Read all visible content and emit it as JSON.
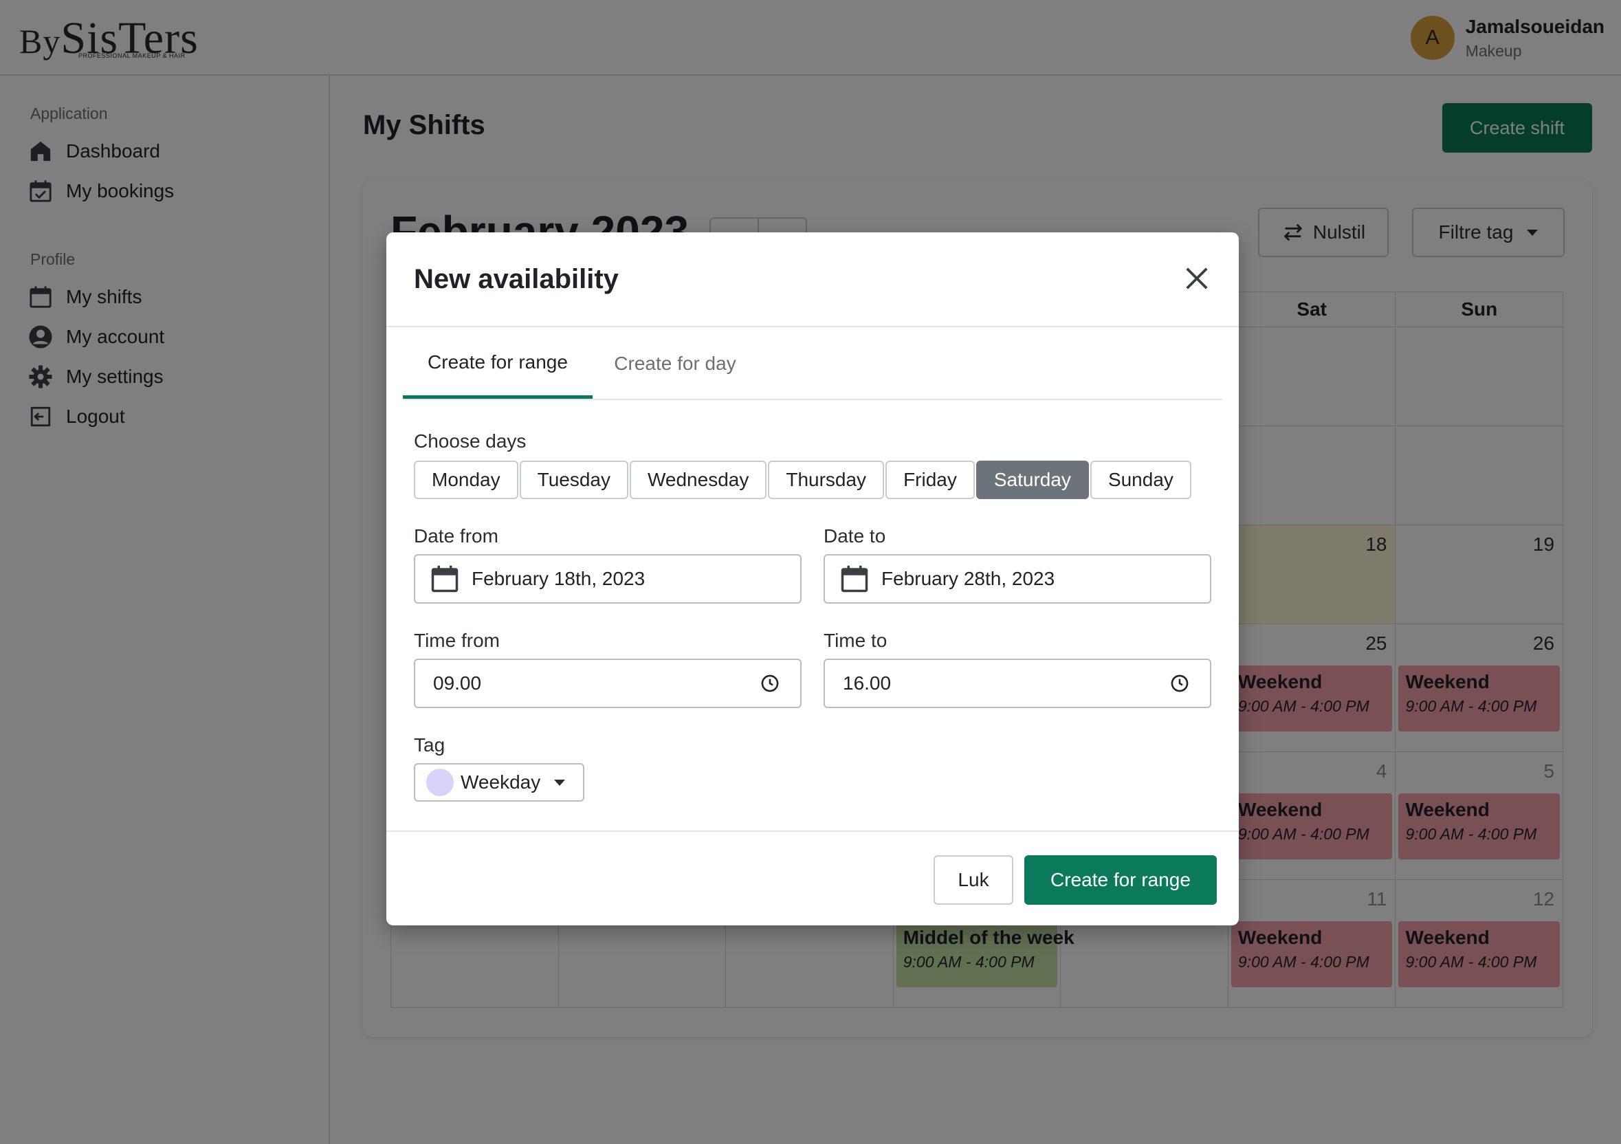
{
  "brand": {
    "logo_text_left": "By",
    "logo_text_main": "SisTers",
    "logo_tagline": "PROFESSIONAL MAKEUP & HAIR"
  },
  "user": {
    "avatar_letter": "A",
    "name": "Jamalsoueidan",
    "role": "Makeup"
  },
  "sidebar": {
    "sections": [
      {
        "heading": "Application",
        "items": [
          {
            "label": "Dashboard",
            "icon": "home-icon"
          },
          {
            "label": "My bookings",
            "icon": "calendar-check-icon"
          }
        ]
      },
      {
        "heading": "Profile",
        "items": [
          {
            "label": "My shifts",
            "icon": "calendar-icon"
          },
          {
            "label": "My account",
            "icon": "user-circle-icon"
          },
          {
            "label": "My settings",
            "icon": "gear-icon"
          },
          {
            "label": "Logout",
            "icon": "logout-icon"
          }
        ]
      }
    ]
  },
  "page": {
    "title": "My Shifts",
    "create_shift_label": "Create shift",
    "month_title": "February 2023",
    "reset_label": "Nulstil",
    "filter_label": "Filtre tag"
  },
  "calendar": {
    "visible_headers": [
      "Sat",
      "Sun"
    ],
    "rows": [
      {
        "cells": [
          {},
          {},
          {},
          {},
          {},
          {},
          {}
        ]
      },
      {
        "cells": [
          {},
          {},
          {},
          {},
          {},
          {},
          {}
        ]
      },
      {
        "cells": [
          {},
          {},
          {},
          {},
          {},
          {
            "day": "18",
            "today": true
          },
          {
            "day": "19"
          }
        ]
      },
      {
        "cells": [
          {},
          {},
          {},
          {},
          {},
          {
            "day": "25",
            "event": "Weekend",
            "time": "9:00 AM - 4:00 PM"
          },
          {
            "day": "26",
            "event": "Weekend",
            "time": "9:00 AM - 4:00 PM"
          }
        ]
      },
      {
        "cells": [
          {},
          {},
          {},
          {},
          {},
          {
            "day": "4",
            "muted": true,
            "event": "Weekend",
            "time": "9:00 AM - 4:00 PM"
          },
          {
            "day": "5",
            "muted": true,
            "event": "Weekend",
            "time": "9:00 AM - 4:00 PM"
          }
        ]
      },
      {
        "cells": [
          {},
          {},
          {},
          {
            "event": "Middel of the week",
            "time": "9:00 AM - 4:00 PM",
            "kind": "midweek"
          },
          {},
          {
            "day": "11",
            "muted": true,
            "event": "Weekend",
            "time": "9:00 AM - 4:00 PM"
          },
          {
            "day": "12",
            "muted": true,
            "event": "Weekend",
            "time": "9:00 AM - 4:00 PM"
          }
        ]
      }
    ]
  },
  "modal": {
    "title": "New availability",
    "tabs": [
      {
        "label": "Create for range",
        "active": true
      },
      {
        "label": "Create for day",
        "active": false
      }
    ],
    "choose_days_label": "Choose days",
    "days": [
      {
        "label": "Monday",
        "selected": false
      },
      {
        "label": "Tuesday",
        "selected": false
      },
      {
        "label": "Wednesday",
        "selected": false
      },
      {
        "label": "Thursday",
        "selected": false
      },
      {
        "label": "Friday",
        "selected": false
      },
      {
        "label": "Saturday",
        "selected": true
      },
      {
        "label": "Sunday",
        "selected": false
      }
    ],
    "date_from_label": "Date from",
    "date_from_value": "February 18th, 2023",
    "date_to_label": "Date to",
    "date_to_value": "February 28th, 2023",
    "time_from_label": "Time from",
    "time_from_value": "09.00",
    "time_to_label": "Time to",
    "time_to_value": "16.00",
    "tag_label": "Tag",
    "tag_value": "Weekday",
    "cancel_label": "Luk",
    "submit_label": "Create for range"
  },
  "colors": {
    "primary": "#0b7a5a",
    "weekend_event": "#f2a3a8",
    "midweek_event": "#c5e1a5",
    "today_cell": "#fdf6d8",
    "selected_day": "#6c737b",
    "tag_dot": "#d7d3fb",
    "avatar": "#d9a03c"
  }
}
